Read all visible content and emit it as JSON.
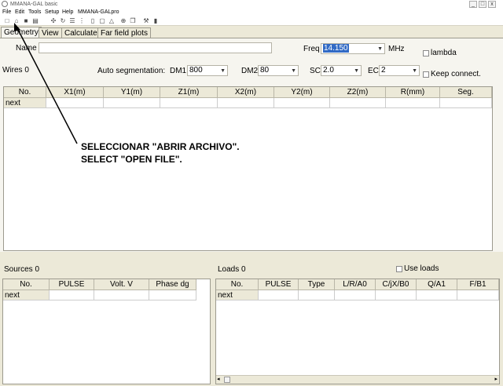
{
  "window": {
    "title": "MMANA-GAL basic",
    "min": "_",
    "max": "□",
    "close": "x"
  },
  "menu": [
    "File",
    "Edit",
    "Tools",
    "Setup",
    "Help",
    "MMANA-GALpro"
  ],
  "toolbar_icons": [
    "new-icon",
    "open-icon",
    "save-icon",
    "print-icon",
    "move-icon",
    "rotate-icon",
    "align-icon",
    "doc-icon",
    "square-icon",
    "triangle-icon",
    "target-icon",
    "copy-icon",
    "tools-icon",
    "trash-icon"
  ],
  "tabs": [
    "Geometry",
    "View",
    "Calculate",
    "Far field plots"
  ],
  "geometry": {
    "name_label": "Name",
    "name_value": "",
    "freq_label": "Freq",
    "freq_value": "14.150",
    "freq_unit": "MHz",
    "lambda_label": "lambda",
    "wires_label": "Wires 0",
    "autoseg_label": "Auto segmentation:",
    "dm1_label": "DM1",
    "dm1_value": "800",
    "dm2_label": "DM2",
    "dm2_value": "80",
    "sc_label": "SC",
    "sc_value": "2.0",
    "ec_label": "EC",
    "ec_value": "2",
    "keep_label": "Keep connect.",
    "columns": [
      "No.",
      "X1(m)",
      "Y1(m)",
      "Z1(m)",
      "X2(m)",
      "Y2(m)",
      "Z2(m)",
      "R(mm)",
      "Seg."
    ],
    "row_label": "next"
  },
  "annotation": {
    "line1": "SELECCIONAR \"ABRIR ARCHIVO\".",
    "line2": "SELECT \"OPEN FILE\"."
  },
  "sources": {
    "label": "Sources 0",
    "columns": [
      "No.",
      "PULSE",
      "Volt. V",
      "Phase dg"
    ],
    "row_label": "next"
  },
  "loads": {
    "label": "Loads 0",
    "use_loads_label": "Use loads",
    "columns": [
      "No.",
      "PULSE",
      "Type",
      "L/R/A0",
      "C/jX/B0",
      "Q/A1",
      "F/B1"
    ],
    "row_label": "next"
  }
}
